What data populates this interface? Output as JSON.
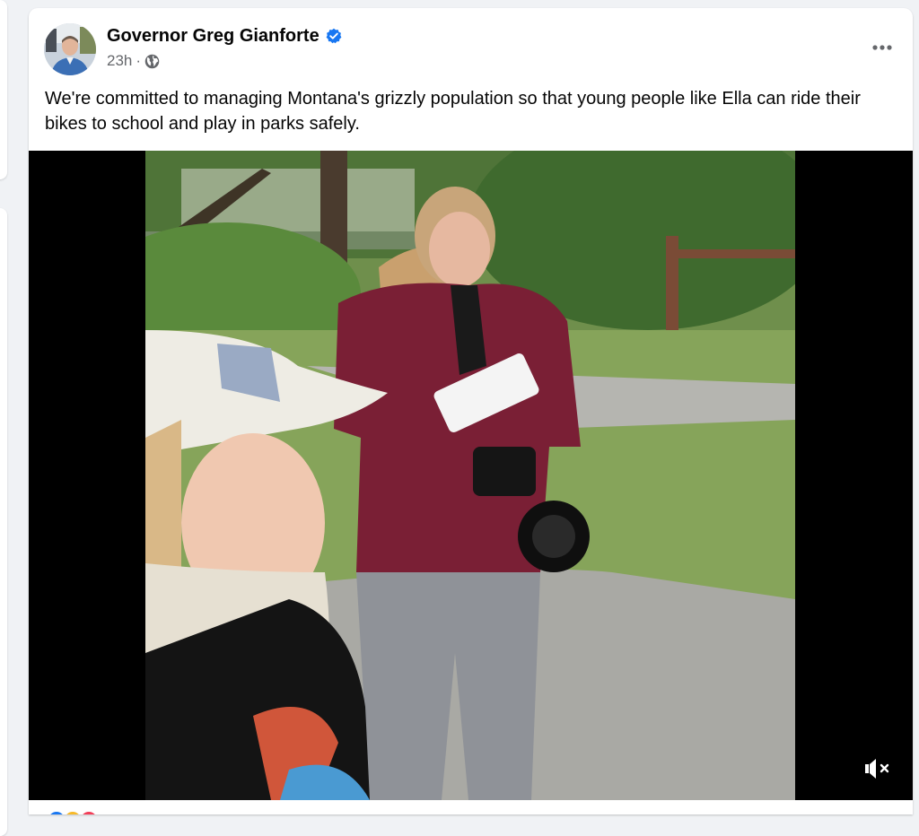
{
  "post": {
    "author_name": "Governor Greg Gianforte",
    "timestamp": "23h",
    "separator": "·",
    "verified_icon": "verified-badge-icon",
    "privacy_icon": "globe-icon",
    "more_icon": "more-options-icon",
    "text": "We're committed to managing Montana's grizzly population so that young people like Ella can ride their bikes to school and play in parks safely."
  },
  "media": {
    "type": "video",
    "mute_icon": "speaker-muted-icon"
  },
  "colors": {
    "verified_blue": "#1877f2",
    "secondary_text": "#65676b",
    "primary_text": "#050505",
    "page_background": "#f0f2f5",
    "card_background": "#ffffff",
    "video_letterbox": "#000000"
  }
}
